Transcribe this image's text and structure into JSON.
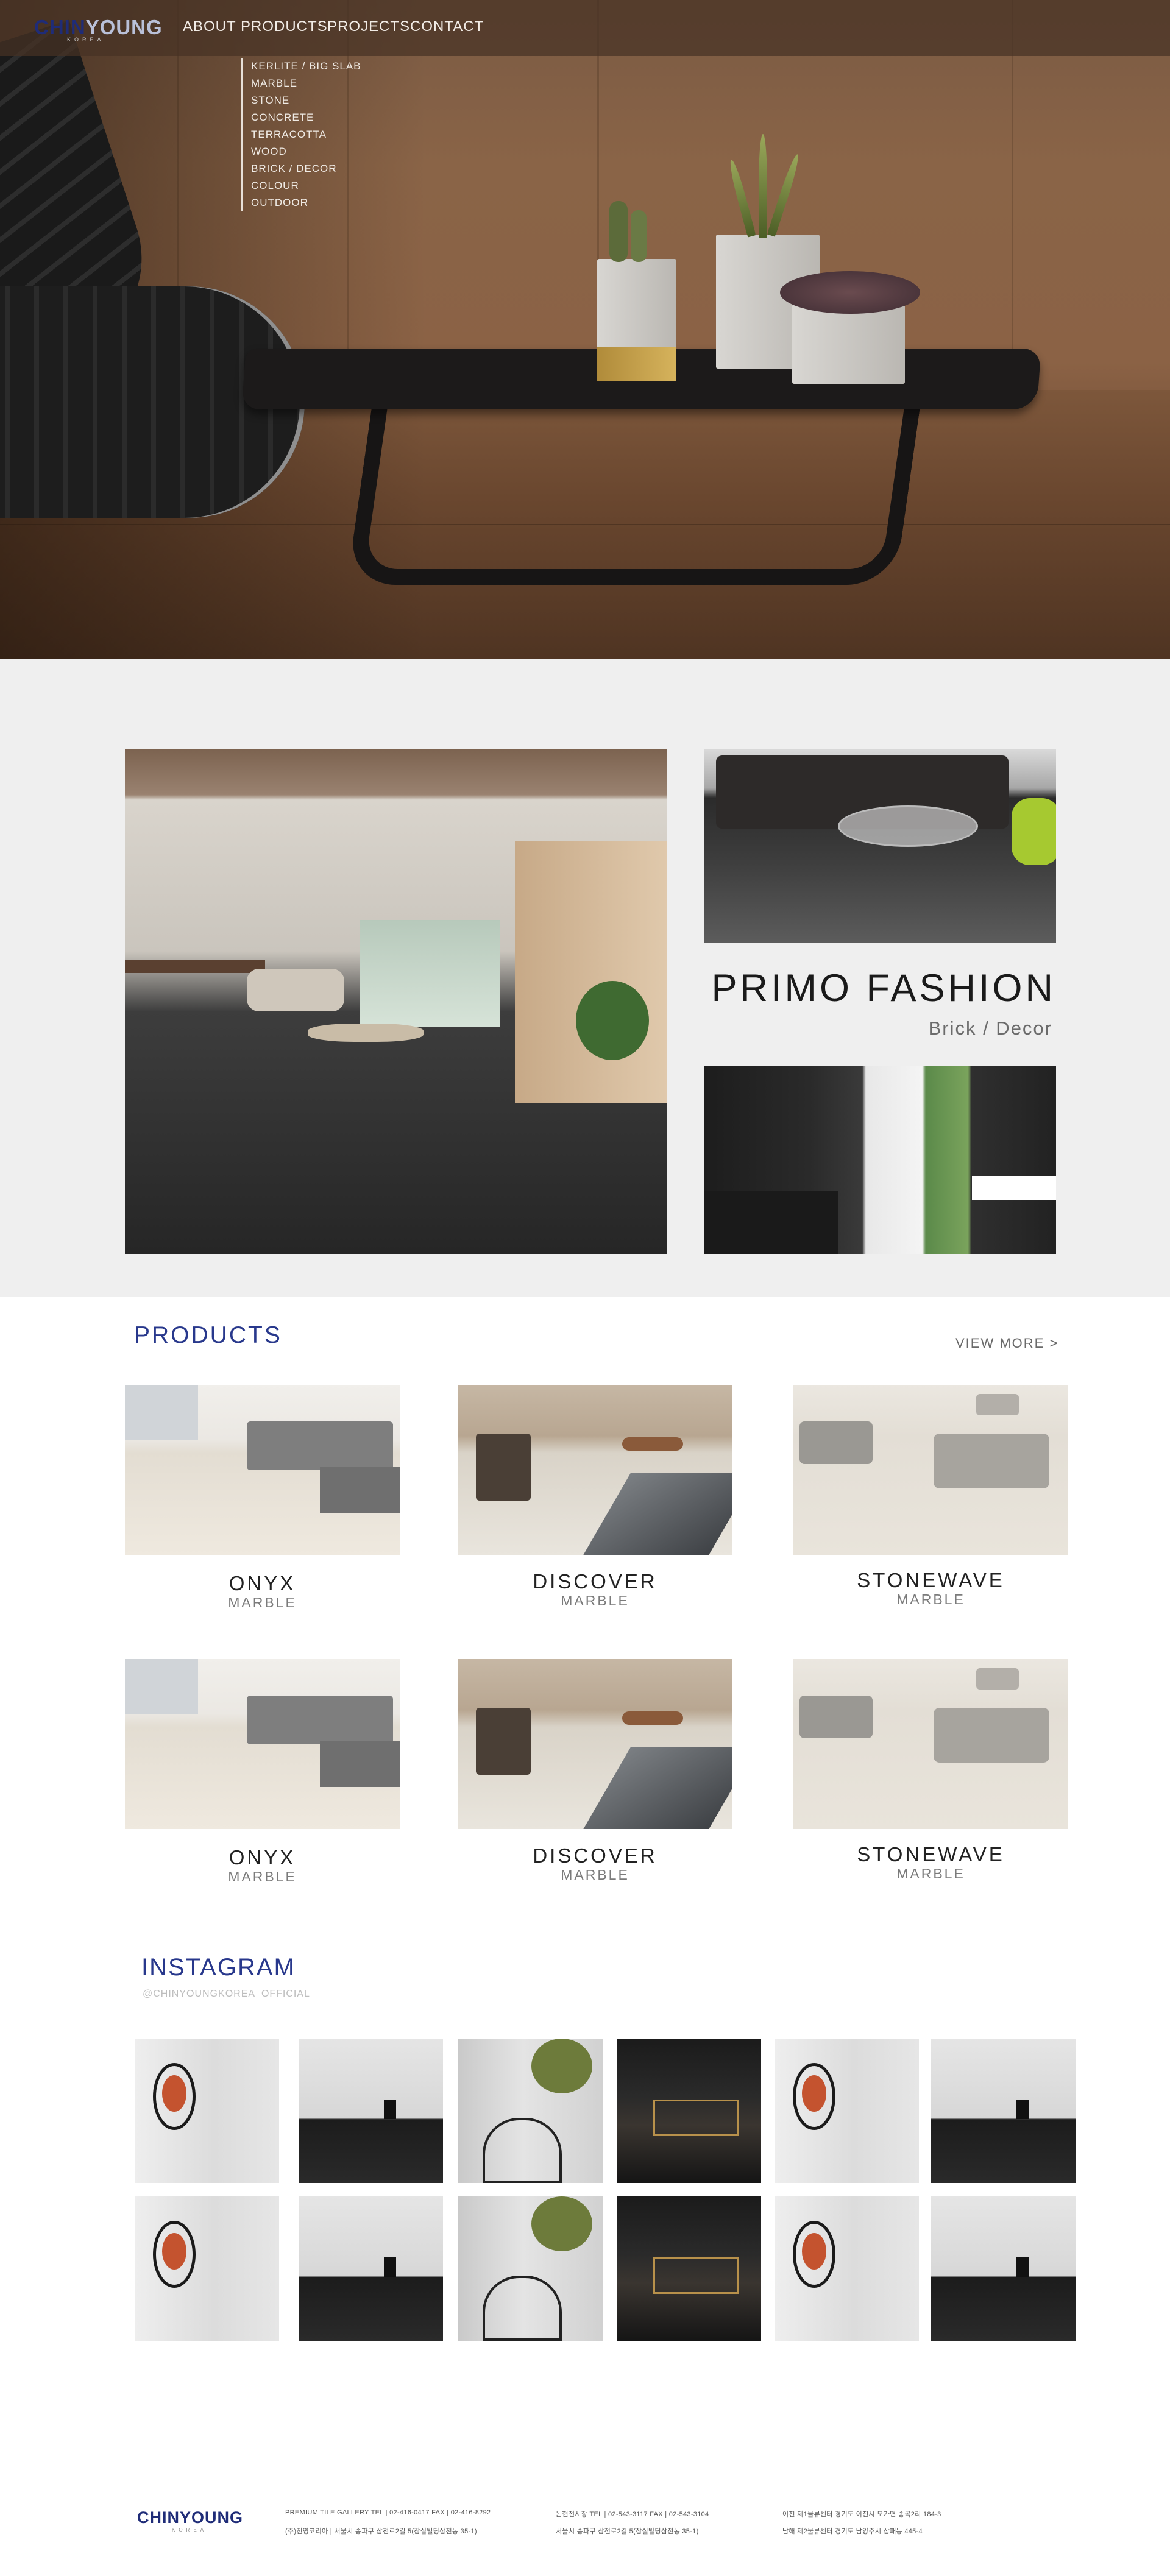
{
  "header": {
    "logo_part1": "CHIN",
    "logo_part2": "YOUNG",
    "logo_sub": "KOREA",
    "nav": [
      "ABOUT",
      "PRODUCTS",
      "PROJECTS",
      "CONTACT"
    ],
    "dropdown": [
      "KERLITE / BIG SLAB",
      "MARBLE",
      "STONE",
      "CONCRETE",
      "TERRACOTTA",
      "WOOD",
      "BRICK / DECOR",
      "COLOUR",
      "OUTDOOR"
    ]
  },
  "feature": {
    "title": "PRIMO FASHION",
    "subtitle": "Brick / Decor"
  },
  "products": {
    "title": "PRODUCTS",
    "view_more": "VIEW MORE >",
    "items": [
      {
        "name": "ONYX",
        "category": "MARBLE"
      },
      {
        "name": "DISCOVER",
        "category": "MARBLE"
      },
      {
        "name": "STONEWAVE",
        "category": "MARBLE"
      },
      {
        "name": "ONYX",
        "category": "MARBLE"
      },
      {
        "name": "DISCOVER",
        "category": "MARBLE"
      },
      {
        "name": "STONEWAVE",
        "category": "MARBLE"
      }
    ]
  },
  "instagram": {
    "title": "INSTAGRAM",
    "handle": "@CHINYOUNGKOREA_OFFICIAL"
  },
  "footer": {
    "logo": "CHINYOUNG",
    "logo_sub": "KOREA",
    "col1_line1": "PREMIUM TILE GALLERY     TEL | 02-416-0417     FAX | 02-416-8292",
    "col1_line2": "(주)진영코리아 | 서울시 송파구 삼전로2길 5(잠실빌딩삼전동 35-1)",
    "col2_line1": "논현전시장     TEL | 02-543-3117     FAX | 02-543-3104",
    "col2_line2": "서울시 송파구 삼전로2길 5(잠실빌딩삼전동 35-1)",
    "col3_line1": "이천 제1물류센터     경기도 이천시 모가면 송곡2리 184-3",
    "col3_line2": "남해 제2물류센터     경기도 남양주시 삼패동 445-4"
  }
}
